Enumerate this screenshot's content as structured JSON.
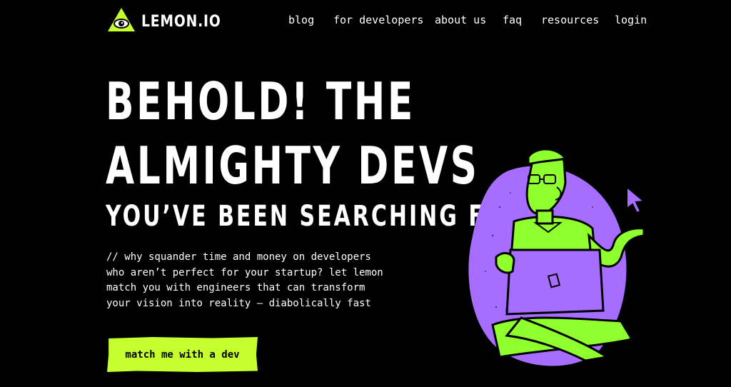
{
  "brand": {
    "name": "LEMON.IO"
  },
  "nav": {
    "items": [
      "blog",
      "for developers",
      "about us",
      "faq",
      "resources",
      "login"
    ]
  },
  "hero": {
    "headline_line1": "BEHOLD! THE",
    "headline_line2": "ALMIGHTY DEVS",
    "headline_line3": "YOU’VE BEEN SEARCHING FOR",
    "description": [
      "// why squander time and money on developers",
      "who aren’t perfect for your startup? let lemon",
      "match you with engineers that can transform",
      "your vision into reality — diabolically fast"
    ],
    "cta_label": "match me with a dev"
  },
  "colors": {
    "accent": "#c6ff2e",
    "purple": "#a66dff",
    "background": "#000000"
  },
  "icons": {
    "logo": "eye-triangle-icon",
    "illustration": "developer-with-laptop-illustration",
    "cursor": "cursor-arrow-icon"
  }
}
